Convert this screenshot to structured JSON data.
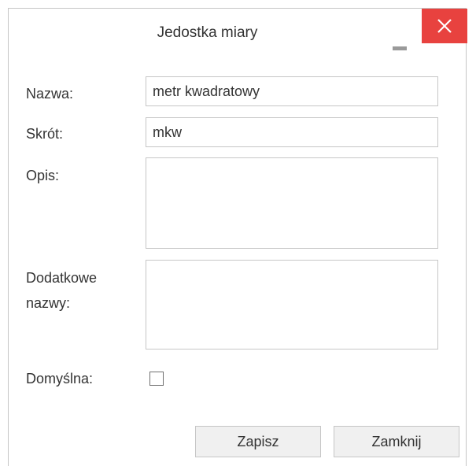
{
  "dialog": {
    "title": "Jedostka miary"
  },
  "form": {
    "name_label": "Nazwa:",
    "name_value": "metr kwadratowy",
    "short_label": "Skrót:",
    "short_value": "mkw",
    "description_label": "Opis:",
    "description_value": "",
    "additional_label_line1": "Dodatkowe",
    "additional_label_line2": "nazwy:",
    "additional_value": "",
    "default_label": "Domyślna:",
    "default_checked": false
  },
  "buttons": {
    "save_label": "Zapisz",
    "close_label": "Zamknij"
  },
  "icons": {
    "minimize": "minimize-icon",
    "close": "close-icon"
  },
  "colors": {
    "close_button": "#e8423f",
    "border": "#c6c6c6",
    "button_bg": "#f0f0f0"
  }
}
